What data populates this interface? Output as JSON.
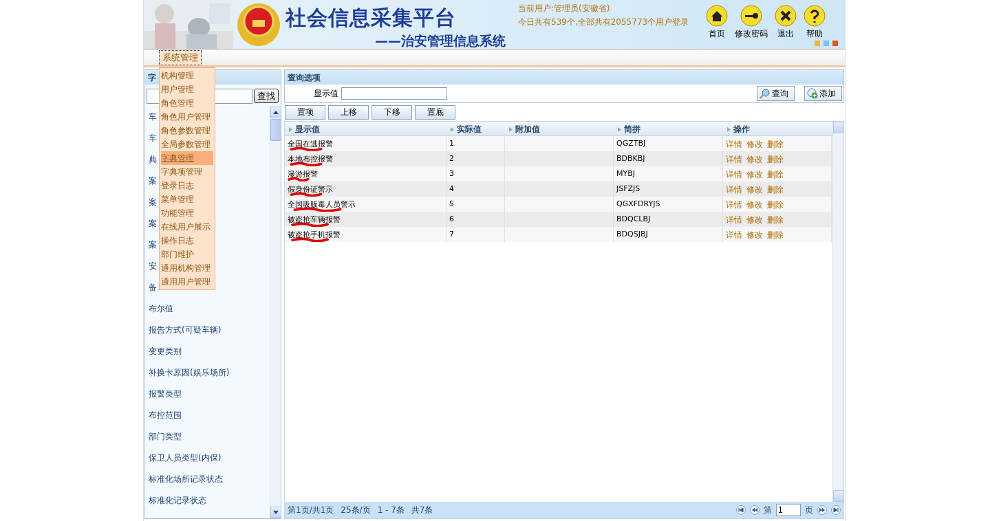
{
  "header": {
    "title": "社会信息采集平台",
    "subtitle": "——治安管理信息系统",
    "user_info": [
      "当前用户:管理员(安徽省)",
      "今日共有539个,全部共有2055773个用户登录"
    ],
    "nav": [
      {
        "kind": "home",
        "label": "首页"
      },
      {
        "kind": "key",
        "label": "修改密码"
      },
      {
        "kind": "exit",
        "label": "退出"
      },
      {
        "kind": "help",
        "label": "帮助"
      }
    ]
  },
  "menu": {
    "tabs": [
      {
        "label": "系统管理",
        "selected": true
      }
    ],
    "dropdown": [
      {
        "label": "机构管理",
        "selected": false
      },
      {
        "label": "用户管理",
        "selected": false
      },
      {
        "label": "角色管理",
        "selected": false
      },
      {
        "label": "角色用户管理",
        "selected": false
      },
      {
        "label": "角色参数管理",
        "selected": false
      },
      {
        "label": "全局参数管理",
        "selected": false
      },
      {
        "label": "字典管理",
        "selected": true
      },
      {
        "label": "字典项管理",
        "selected": false
      },
      {
        "label": "登录日志",
        "selected": false
      },
      {
        "label": "菜单管理",
        "selected": false
      },
      {
        "label": "功能管理",
        "selected": false
      },
      {
        "label": "在线用户展示",
        "selected": false
      },
      {
        "label": "操作日志",
        "selected": false
      },
      {
        "label": "部门维护",
        "selected": false
      },
      {
        "label": "通用机构管理",
        "selected": false
      },
      {
        "label": "通用用户管理",
        "selected": false
      }
    ]
  },
  "sidebar": {
    "title": "字",
    "search_button": "查找",
    "items": [
      "车",
      "车",
      "典",
      "案",
      "案",
      "案",
      "案",
      "安",
      "备",
      "布尔值",
      "报告方式(可疑车辆)",
      "变更类别",
      "补换卡原因(娱乐场所)",
      "报警类型",
      "布控范围",
      "部门类型",
      "保卫人员类型(内保)",
      "标准化场所记录状态",
      "标准化记录状态"
    ]
  },
  "query": {
    "title": "查询选项",
    "field_label": "显示值",
    "buttons": [
      {
        "kind": "search",
        "label": "查询"
      },
      {
        "kind": "add",
        "label": "添加"
      }
    ]
  },
  "toolbar": [
    "置项",
    "上移",
    "下移",
    "置底"
  ],
  "table": {
    "columns": [
      "显示值",
      "实际值",
      "附加值",
      "简拼",
      "操作"
    ],
    "rows": [
      {
        "display": "全国在逃报警",
        "value": "1",
        "abbr": "QGZTBJ",
        "actions": [
          "详情",
          "修改",
          "删除"
        ]
      },
      {
        "display": "本地布控报警",
        "value": "2",
        "abbr": "BDBKBJ",
        "actions": [
          "详情",
          "修改",
          "删除"
        ]
      },
      {
        "display": "漫游报警",
        "value": "3",
        "abbr": "MYBJ",
        "actions": [
          "详情",
          "修改",
          "删除"
        ]
      },
      {
        "display": "假身份证警示",
        "value": "4",
        "abbr": "JSFZJS",
        "actions": [
          "详情",
          "修改",
          "删除"
        ]
      },
      {
        "display": "全国吸贩毒人员警示",
        "value": "5",
        "abbr": "QGXFDRYJS",
        "actions": [
          "详情",
          "修改",
          "删除"
        ]
      },
      {
        "display": "被盗抢车辆报警",
        "value": "6",
        "abbr": "BDQCLBJ",
        "actions": [
          "详情",
          "修改",
          "删除"
        ]
      },
      {
        "display": "被盗抢手机报警",
        "value": "7",
        "abbr": "BDQSJBJ",
        "actions": [
          "详情",
          "修改",
          "删除"
        ]
      }
    ]
  },
  "pager": {
    "info": [
      "第1页/共1页",
      "25条/页",
      "1 - 7条",
      "共7条"
    ],
    "page_prefix": "第",
    "page_value": "1",
    "page_suffix": "页"
  }
}
